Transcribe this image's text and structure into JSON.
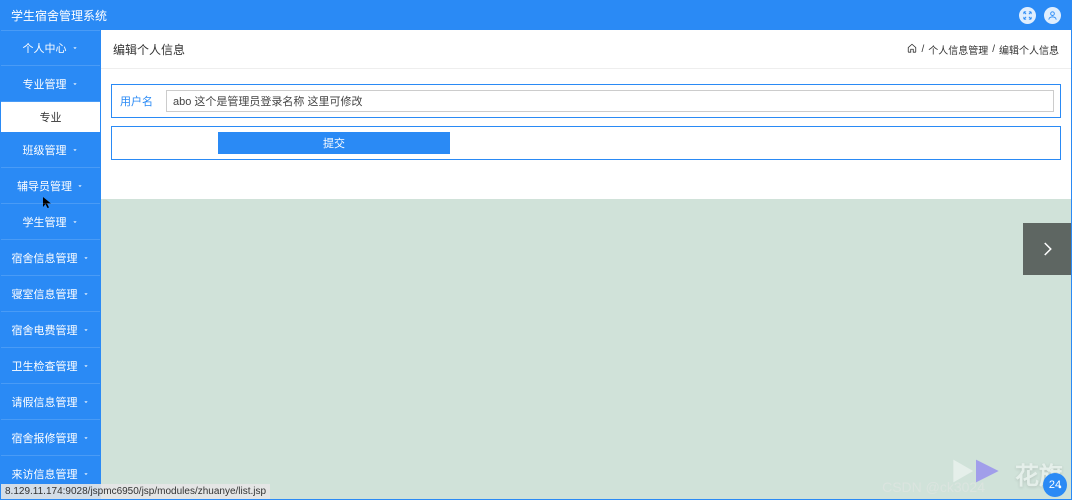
{
  "header": {
    "title": "学生宿舍管理系统"
  },
  "sidebar": {
    "items": [
      {
        "label": "个人中心",
        "active": false
      },
      {
        "label": "专业管理",
        "active": false
      },
      {
        "label": "专业",
        "active": true
      },
      {
        "label": "班级管理",
        "active": false
      },
      {
        "label": "辅导员管理",
        "active": false
      },
      {
        "label": "学生管理",
        "active": false
      },
      {
        "label": "宿舍信息管理",
        "active": false
      },
      {
        "label": "寝室信息管理",
        "active": false
      },
      {
        "label": "宿舍电费管理",
        "active": false
      },
      {
        "label": "卫生检查管理",
        "active": false
      },
      {
        "label": "请假信息管理",
        "active": false
      },
      {
        "label": "宿舍报修管理",
        "active": false
      },
      {
        "label": "来访信息管理",
        "active": false
      }
    ]
  },
  "content": {
    "title": "编辑个人信息",
    "breadcrumb": {
      "sep": "/",
      "a": "个人信息管理",
      "b": "编辑个人信息"
    },
    "form": {
      "username_label": "用户名",
      "username_value": "abo 这个是管理员登录名称 这里可修改",
      "submit_label": "提交"
    }
  },
  "status_bar": {
    "text": "8.129.11.174:9028/jspmc6950/jsp/modules/zhuanye/list.jsp"
  },
  "watermark": {
    "text": "花旗",
    "sub": "CSDN @ck3024"
  },
  "badge": {
    "count": "24"
  }
}
